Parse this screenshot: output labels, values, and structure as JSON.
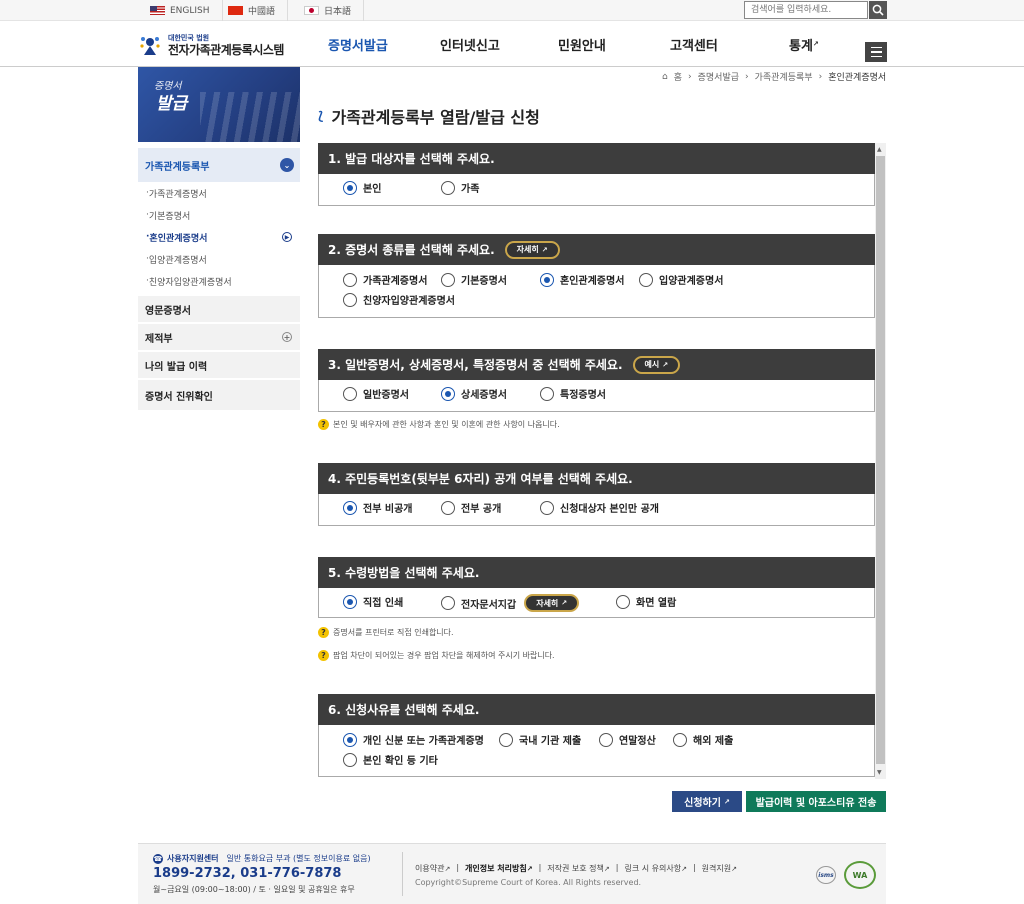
{
  "top_bar": {
    "languages": [
      "ENGLISH",
      "中國語",
      "日本語"
    ],
    "search_placeholder": "검색어를 입력하세요."
  },
  "header": {
    "logo_line1": "대한민국 법원",
    "logo_line2": "전자가족관계등록시스템",
    "nav": [
      {
        "label": "증명서발급",
        "active": true
      },
      {
        "label": "인터넷신고",
        "active": false
      },
      {
        "label": "민원안내",
        "active": false
      },
      {
        "label": "고객센터",
        "active": false
      },
      {
        "label": "통계",
        "active": false
      }
    ]
  },
  "banner": {
    "line1": "증명서",
    "line2": "발급"
  },
  "sidebar": {
    "open_category": "가족관계등록부",
    "sub_items": [
      {
        "label": "가족관계증명서",
        "active": false
      },
      {
        "label": "기본증명서",
        "active": false
      },
      {
        "label": "혼인관계증명서",
        "active": true
      },
      {
        "label": "입양관계증명서",
        "active": false
      },
      {
        "label": "친양자입양관계증명서",
        "active": false
      }
    ],
    "categories": [
      "영문증명서",
      "제적부",
      "나의 발급 이력",
      "증명서 진위확인"
    ]
  },
  "breadcrumb": [
    "홈",
    "증명서발급",
    "가족관계등록부",
    "혼인관계증명서"
  ],
  "page_title": "가족관계등록부 열람/발급 신청",
  "sections": [
    {
      "title": "1. 발급 대상자를 선택해 주세요.",
      "options": [
        {
          "label": "본인",
          "selected": true
        },
        {
          "label": "가족",
          "selected": false
        }
      ]
    },
    {
      "title": "2. 증명서 종류를 선택해 주세요.",
      "pill": "자세히",
      "options": [
        {
          "label": "가족관계증명서",
          "selected": false
        },
        {
          "label": "기본증명서",
          "selected": false
        },
        {
          "label": "혼인관계증명서",
          "selected": true
        },
        {
          "label": "입양관계증명서",
          "selected": false
        },
        {
          "label": "친양자입양관계증명서",
          "selected": false
        }
      ]
    },
    {
      "title": "3. 일반증명서, 상세증명서, 특정증명서 중 선택해 주세요.",
      "pill": "예시",
      "options": [
        {
          "label": "일반증명서",
          "selected": false
        },
        {
          "label": "상세증명서",
          "selected": true
        },
        {
          "label": "특정증명서",
          "selected": false
        }
      ],
      "notes": [
        "본인 및 배우자에 관한 사항과 혼인 및 이혼에 관한 사항이 나옵니다."
      ]
    },
    {
      "title": "4. 주민등록번호(뒷부분 6자리) 공개 여부를 선택해 주세요.",
      "options": [
        {
          "label": "전부 비공개",
          "selected": true
        },
        {
          "label": "전부 공개",
          "selected": false
        },
        {
          "label": "신청대상자 본인만 공개",
          "selected": false
        }
      ]
    },
    {
      "title": "5. 수령방법을 선택해 주세요.",
      "pill": "자세히",
      "options": [
        {
          "label": "직접 인쇄",
          "selected": true
        },
        {
          "label": "전자문서지갑",
          "selected": false
        },
        {
          "label": "화면 열람",
          "selected": false
        }
      ],
      "notes": [
        "증명서를 프린터로 직접 인쇄합니다.",
        "팝업 차단이 되어있는 경우 팝업 차단을 해제하여 주시기 바랍니다."
      ]
    },
    {
      "title": "6. 신청사유를 선택해 주세요.",
      "options": [
        {
          "label": "개인 신분 또는 가족관계증명",
          "selected": true
        },
        {
          "label": "국내 기관 제출",
          "selected": false
        },
        {
          "label": "연말정산",
          "selected": false
        },
        {
          "label": "해외 제출",
          "selected": false
        },
        {
          "label": "본인 확인 등 기타",
          "selected": false
        }
      ]
    }
  ],
  "buttons": {
    "apply": "신청하기",
    "history": "발급이력 및 아포스티유 전송"
  },
  "footer": {
    "center_label": "사용자지원센터",
    "center_note": "일반 통화요금 부과 (별도 정보이용료 없음)",
    "phone": "1899-2732, 031-776-7878",
    "hours": "월~금요일 (09:00~18:00) / 토 · 일요일 및 공휴일은 휴무",
    "links": [
      "이용약관",
      "개인정보 처리방침",
      "저작권 보호 정책",
      "링크 시 유의사항",
      "원격지원"
    ],
    "copyright": "Copyright©Supreme Court of Korea. All Rights reserved.",
    "badges": [
      "isms",
      "WA"
    ]
  },
  "colors": {
    "primary": "#1a56b0",
    "section_header": "#3d3d3d",
    "apply_btn": "#2b4a86",
    "history_btn": "#0f7a5a"
  }
}
